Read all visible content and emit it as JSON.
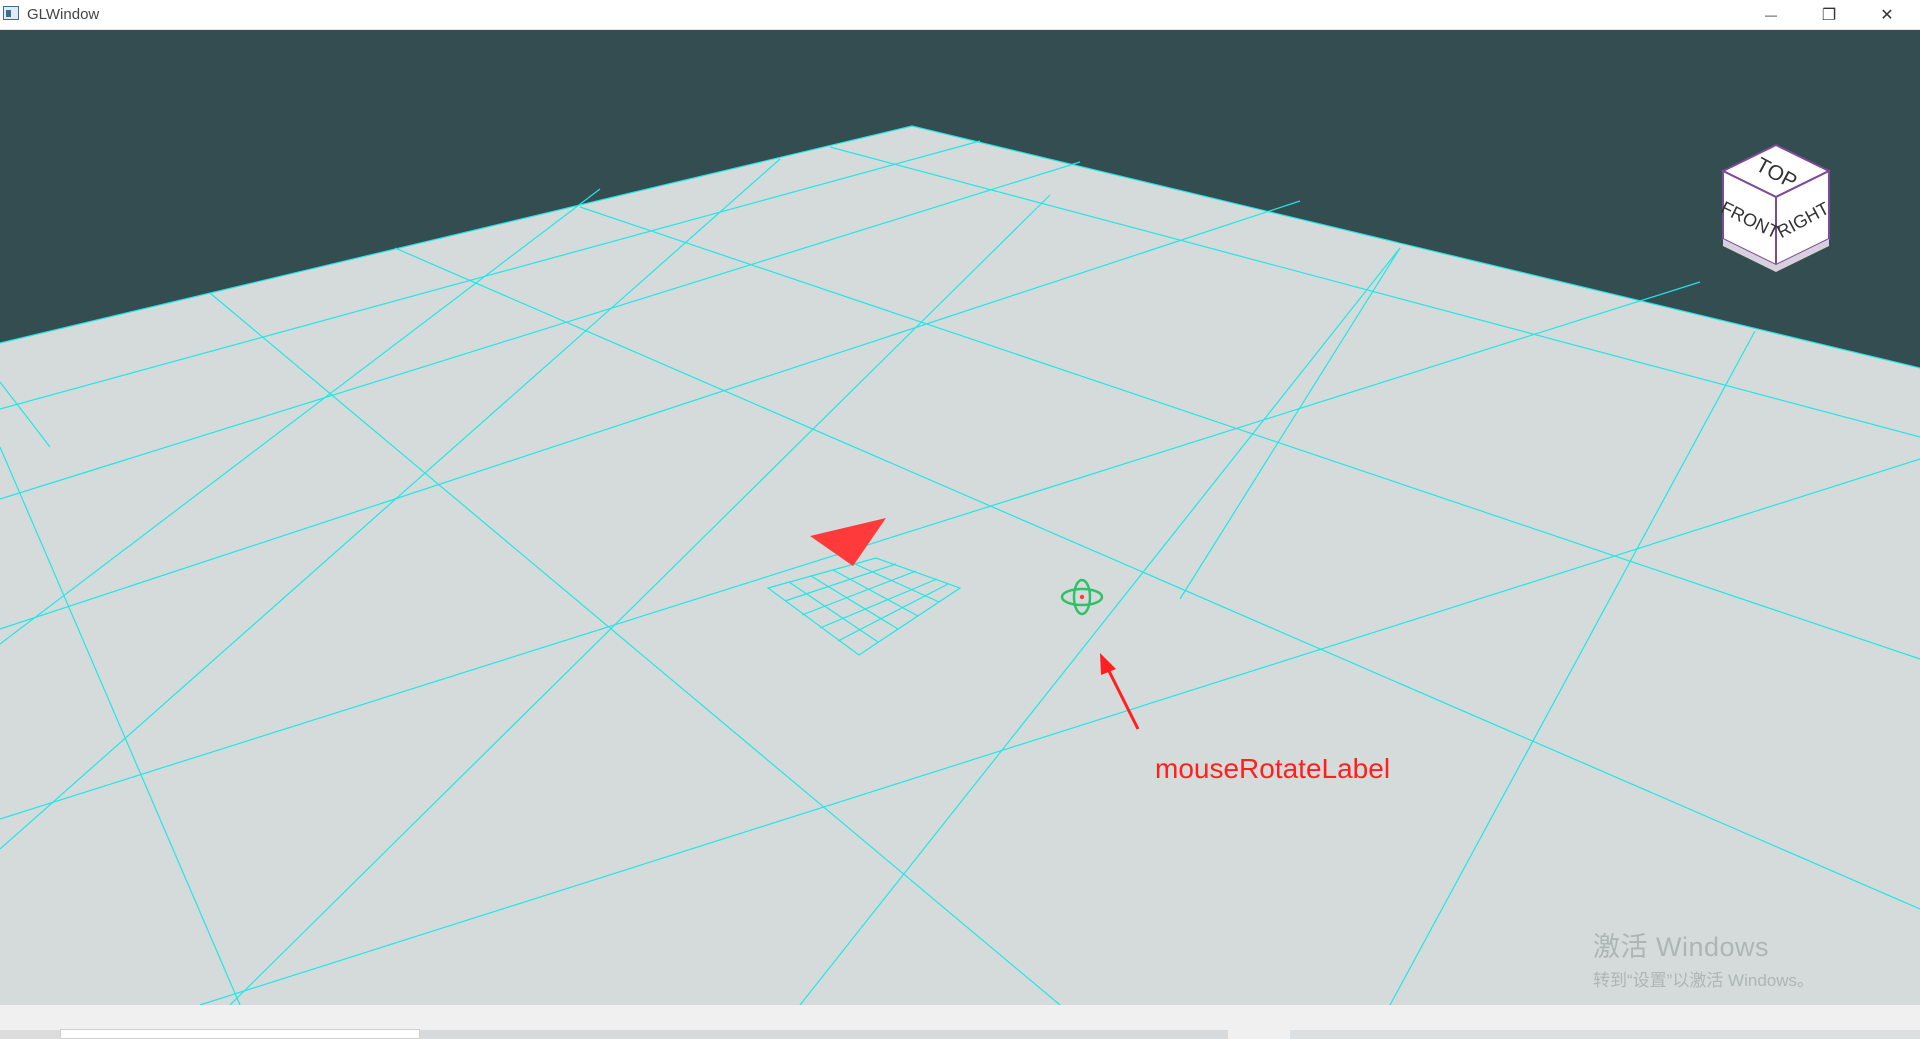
{
  "window": {
    "title": "GLWindow",
    "controls": {
      "minimize": "—",
      "maximize": "❐",
      "close": "✕"
    }
  },
  "scene": {
    "background_color": "#344d50",
    "floor_color": "#d5dbdb",
    "grid_color": "#22e6e6",
    "marker_color": "#ff3a3a"
  },
  "view_cube": {
    "top_label": "TOP",
    "front_label": "FRONT",
    "right_label": "RIGHT"
  },
  "annotation": {
    "label": "mouseRotateLabel",
    "color": "#ff1f1f"
  },
  "watermark": {
    "title": "激活 Windows",
    "subtitle": "转到“设置”以激活 Windows。"
  }
}
